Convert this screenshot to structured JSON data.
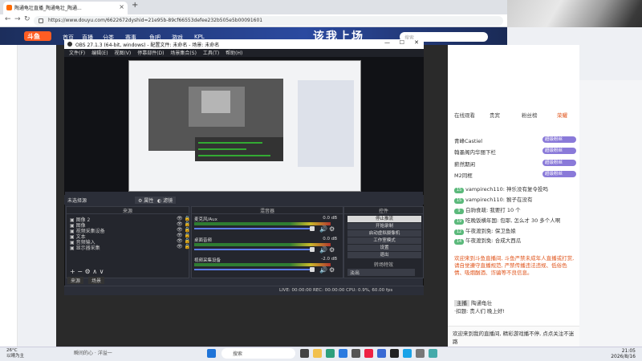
{
  "browser": {
    "tab_title": "陶通龟壮直播_陶通龟壮_陶通...",
    "url": "https://www.douyu.com/6622672dyshid=21e95b-89cf66553defee232b505e5b00091601"
  },
  "site": {
    "logo": "斗鱼",
    "nav": [
      "首页",
      "直播",
      "分类",
      "赛事",
      "鱼吧",
      "游戏",
      "KPL"
    ],
    "banner": "该我上场",
    "search_placeholder": "搜索"
  },
  "obs": {
    "title": "OBS 27.1.3 (64-bit, windows) - 配置文件: 未命名 - 场景: 未命名",
    "menu": [
      "文件(F)",
      "编辑(E)",
      "视图(V)",
      "停靠部件(D)",
      "场景集合(S)",
      "工具(T)",
      "帮助(H)"
    ],
    "scene_label": "未选择源",
    "props": "属性",
    "filters": "滤镜",
    "docks": {
      "scenes": "场景",
      "sources": "来源",
      "mixer": "混音器",
      "controls": "控件",
      "transitions": "转场特效"
    },
    "sources": [
      "图像 2",
      "图像",
      "视频采集设备",
      "文本",
      "音频输入",
      "显示器采集"
    ],
    "mixer_tracks": [
      {
        "name": "麦克风/Aux",
        "db": "0.0 dB"
      },
      {
        "name": "桌面音频",
        "db": "0.0 dB"
      },
      {
        "name": "视频采集设备",
        "db": "-2.0 dB"
      }
    ],
    "controls": [
      "停止推流",
      "开始录制",
      "启动虚拟摄像机",
      "工作室模式",
      "设置",
      "退出"
    ],
    "transition": "淡出",
    "bottom_tabs": [
      "来源",
      "场景"
    ],
    "status": "LIVE: 00:00:00    REC: 00:00:00    CPU: 0.9%, 60.00 fps"
  },
  "chat": {
    "tabs": [
      "在线观看",
      "贵宾",
      "粉丝榜",
      "荣耀"
    ],
    "ranks": [
      {
        "name": "青峰Castiel",
        "badge": "超级粉丝"
      },
      {
        "name": "翰墨阁内华丽下栏",
        "badge": "超级粉丝"
      },
      {
        "name": "薪然期闲",
        "badge": "超级粉丝"
      },
      {
        "name": "M2同框",
        "badge": "超级粉丝"
      }
    ],
    "messages": [
      {
        "lv": "15",
        "text": "vampirech110: 神乐没有复令投吗"
      },
      {
        "lv": "15",
        "text": "vampirech110: 猴子在没有"
      },
      {
        "lv": "9",
        "text": "白驹食疏: 我要打 10 个"
      },
      {
        "lv": "19",
        "text": "吃晚饭横年国: 包耶, 怎么才 30 多个人啊"
      },
      {
        "lv": "12",
        "text": "午夜渡到免: 保卫鱼娘"
      },
      {
        "lv": "14",
        "text": "午夜渡到免: 合成大西瓜"
      }
    ],
    "system_notice": "欢迎来到斗鱼直播间, 斗鱼严禁未成年人直播或打赏, 请自觉遵守直播规范, 严禁传播违法违规、低俗色情、吸烟酗酒、诈骗等不良信息。",
    "anchor_name": "主播",
    "anchor_room": "陶通龟壮",
    "anchor_tip": "·扣题: 贵人们 晚上好!",
    "welcome": "欢迎来到我的直播间, 精彩游戏播不停, 点点关注不迷路"
  },
  "taskbar": {
    "weather_temp": "26°C",
    "weather_desc": "以晴为主",
    "news": "瞬间的心 · 洋溢一",
    "search": "搜索",
    "time": "21:05",
    "date": "2026/8/16"
  }
}
